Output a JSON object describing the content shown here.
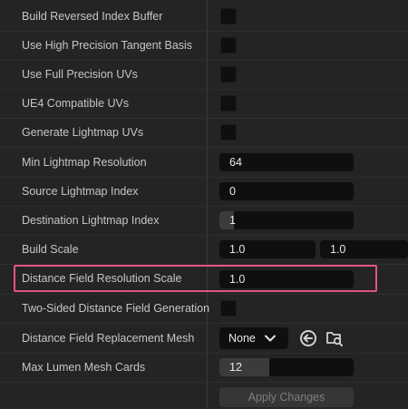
{
  "rows": {
    "build_reversed_index_buffer": {
      "label": "Build Reversed Index Buffer"
    },
    "use_high_precision_tangent_basis": {
      "label": "Use High Precision Tangent Basis"
    },
    "use_full_precision_uvs": {
      "label": "Use Full Precision UVs"
    },
    "ue4_compatible_uvs": {
      "label": "UE4 Compatible UVs"
    },
    "generate_lightmap_uvs": {
      "label": "Generate Lightmap UVs"
    },
    "min_lightmap_resolution": {
      "label": "Min Lightmap Resolution",
      "value": "64"
    },
    "source_lightmap_index": {
      "label": "Source Lightmap Index",
      "value": "0"
    },
    "destination_lightmap_index": {
      "label": "Destination Lightmap Index",
      "value": "1"
    },
    "build_scale": {
      "label": "Build Scale",
      "x": "1.0",
      "y": "1.0"
    },
    "distance_field_resolution_scale": {
      "label": "Distance Field Resolution Scale",
      "value": "1.0"
    },
    "two_sided_distance_field_generation": {
      "label": "Two-Sided Distance Field Generation"
    },
    "distance_field_replacement_mesh": {
      "label": "Distance Field Replacement Mesh",
      "value": "None"
    },
    "max_lumen_mesh_cards": {
      "label": "Max Lumen Mesh Cards",
      "value": "12"
    }
  },
  "apply_button": {
    "label": "Apply Changes"
  },
  "icons": {
    "use_selected": "arrow-left-circle-icon",
    "browse": "folder-search-icon",
    "dropdown": "chevron-down-icon"
  },
  "colors": {
    "highlight": "#e3557f",
    "background": "#242424",
    "field": "#0f0f0f"
  },
  "spinbox_levels": {
    "destination_lightmap_index": 0.11,
    "max_lumen_mesh_cards": 0.37
  }
}
